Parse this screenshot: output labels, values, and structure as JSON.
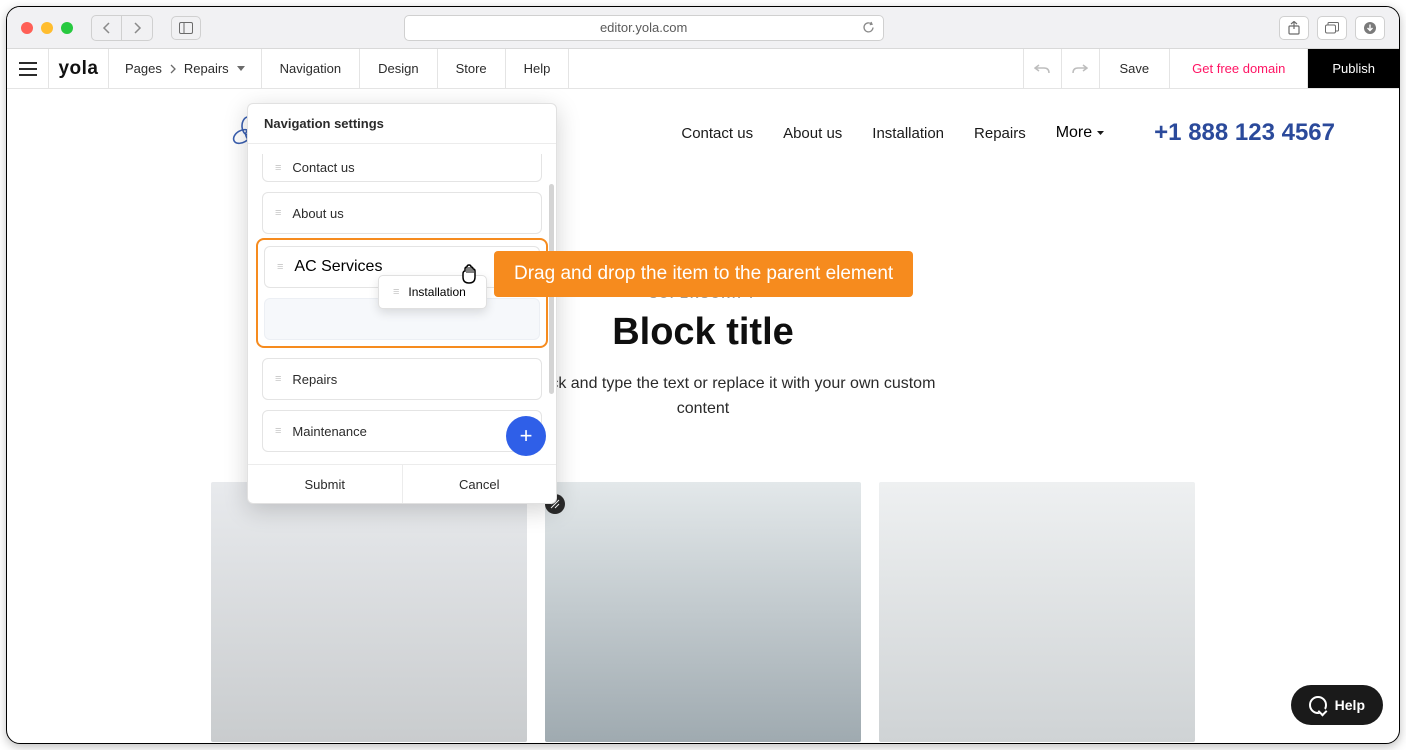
{
  "browser": {
    "url": "editor.yola.com"
  },
  "toolbar": {
    "logo": "yola",
    "pages_label": "Pages",
    "breadcrumb_current": "Repairs",
    "navigation": "Navigation",
    "design": "Design",
    "store": "Store",
    "help": "Help",
    "save": "Save",
    "get_domain": "Get free domain",
    "publish": "Publish"
  },
  "site": {
    "nav": {
      "contact": "Contact us",
      "about": "About us",
      "installation": "Installation",
      "repairs": "Repairs",
      "more": "More"
    },
    "phone": "+1 888 123 4567"
  },
  "content": {
    "superscript": "SUPERSCRIPT",
    "title": "Block title",
    "desc_line1": ". To edit, click and type the text or replace it with your own custom",
    "desc_line2": "content"
  },
  "navpanel": {
    "title": "Navigation settings",
    "items": {
      "contact": "Contact us",
      "about": "About us",
      "ac_services": "AC Services",
      "installation": "Installation",
      "repairs": "Repairs",
      "maintenance": "Maintenance"
    },
    "submit": "Submit",
    "cancel": "Cancel"
  },
  "callout": {
    "text": "Drag and drop the item to the parent element"
  },
  "help": {
    "label": "Help"
  }
}
